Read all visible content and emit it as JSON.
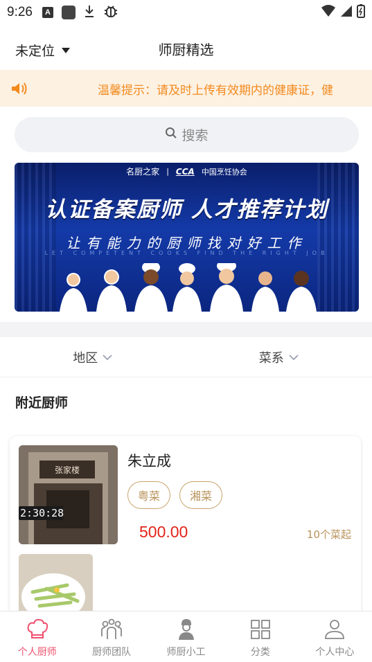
{
  "status_bar": {
    "time": "9:26",
    "a_badge": "A"
  },
  "header": {
    "location": "未定位",
    "title": "师厨精选"
  },
  "notice": {
    "text": "温馨提示：请及时上传有效期内的健康证，健"
  },
  "search": {
    "placeholder": "搜索"
  },
  "banner": {
    "logo_left": "名厨之家",
    "logo_mid": "CCA",
    "logo_right": "中国烹饪协会",
    "title": "认证备案厨师 人才推荐计划",
    "subtitle": "让有能力的厨师找对好工作",
    "subtitle_en": "LET COMPETENT COOKS FIND THE RIGHT JOB"
  },
  "filters": [
    {
      "label": "地区"
    },
    {
      "label": "菜系"
    }
  ],
  "section_title": "附近厨师",
  "chef_card": {
    "name": "朱立成",
    "tags": [
      "粤菜",
      "湘菜"
    ],
    "price": "500.00",
    "min_dishes": "10个菜起",
    "thumb_clock": "2:30:28",
    "thumb_sign": "张家楼"
  },
  "bottom_nav": [
    {
      "label": "个人厨师",
      "icon": "chef-hat-icon",
      "active": true
    },
    {
      "label": "厨师团队",
      "icon": "team-icon",
      "active": false
    },
    {
      "label": "师厨小工",
      "icon": "worker-icon",
      "active": false
    },
    {
      "label": "分类",
      "icon": "grid-icon",
      "active": false
    },
    {
      "label": "个人中心",
      "icon": "user-icon",
      "active": false
    }
  ],
  "colors": {
    "accent": "#f0506e",
    "notice_text": "#f38a1e",
    "notice_bg": "#fdf1e2",
    "price": "#e2231a",
    "tag": "#b8925a"
  }
}
